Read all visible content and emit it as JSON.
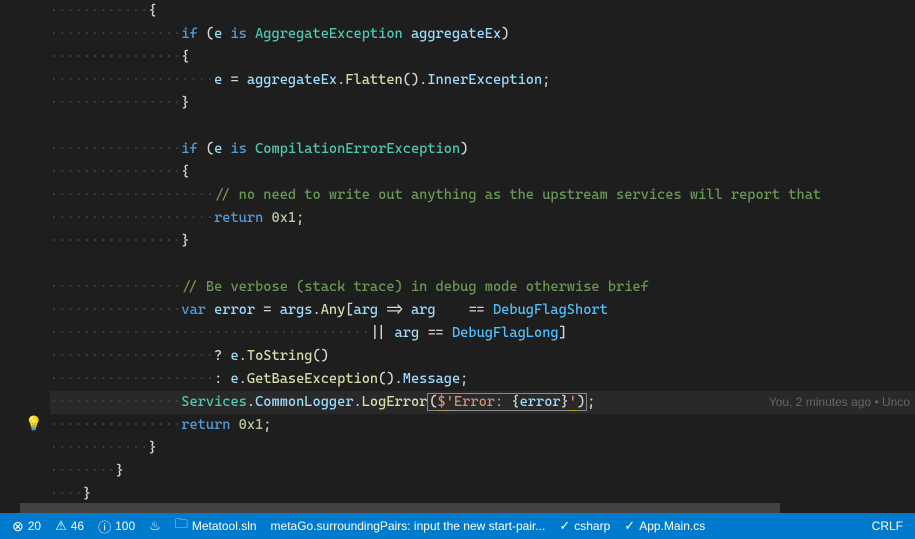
{
  "code": {
    "l1": "{",
    "l2_if": "if",
    "l2_paren_open": " (",
    "l2_e": "e",
    "l2_is": " is ",
    "l2_type": "AggregateException",
    "l2_var": " aggregateEx",
    "l2_paren_close": ")",
    "l3": "{",
    "l4_e": "e",
    "l4_eq": " = ",
    "l4_var": "aggregateEx",
    "l4_dot": ".",
    "l4_flatten": "Flatten",
    "l4_parens": "().",
    "l4_inner": "InnerException",
    "l4_semi": ";",
    "l5": "}",
    "l7_if": "if",
    "l7_paren_open": " (",
    "l7_e": "e",
    "l7_is": " is ",
    "l7_type": "CompilationErrorException",
    "l7_paren_close": ")",
    "l8": "{",
    "l9_comment": "// no need to write out anything as the upstream services will report that",
    "l10_return": "return",
    "l10_val": " 0x1",
    "l10_semi": ";",
    "l11": "}",
    "l13_comment": "// Be verbose (stack trace) in debug mode otherwise brief",
    "l14_var": "var",
    "l14_error": " error",
    "l14_eq": " = ",
    "l14_args": "args",
    "l14_dot": ".",
    "l14_any": "Any",
    "l14_bracket_o": "[",
    "l14_arg": "arg",
    "l14_arrow": " => ",
    "l14_arg2": "arg",
    "l14_eq2": "    == ",
    "l14_dfs": "DebugFlagShort",
    "l15_or": "|| ",
    "l15_arg": "arg",
    "l15_eq": " == ",
    "l15_dfl": "DebugFlagLong",
    "l15_bracket_c": "]",
    "l16_q": "? ",
    "l16_e": "e",
    "l16_dot": ".",
    "l16_tostring": "ToString",
    "l16_parens": "()",
    "l17_colon": ": ",
    "l17_e": "e",
    "l17_dot": ".",
    "l17_getbase": "GetBaseException",
    "l17_parens": "().",
    "l17_msg": "Message",
    "l17_semi": ";",
    "l18_svc": "Services",
    "l18_dot": ".",
    "l18_cl": "CommonLogger",
    "l18_dot2": ".",
    "l18_log": "LogError",
    "l18_po": "(",
    "l18_dollar": "$",
    "l18_q1": "'",
    "l18_str": "Error: ",
    "l18_bo": "{",
    "l18_err": "error",
    "l18_bc": "}",
    "l18_q2": "'",
    "l18_pc": ")",
    "l18_semi": ";",
    "l19_return": "return",
    "l19_val": " 0x1",
    "l19_semi": ";",
    "l20": "}",
    "l21": "}",
    "l22": "}"
  },
  "codelens": "You, 2 minutes ago • Unco",
  "statusbar": {
    "errors": "20",
    "warnings": "46",
    "info": "100",
    "solution": "Metatool.sln",
    "command": "metaGo.surroundingPairs: input the new start-pair...",
    "lang": "csharp",
    "file": "App.Main.cs",
    "eol": "CRLF"
  }
}
